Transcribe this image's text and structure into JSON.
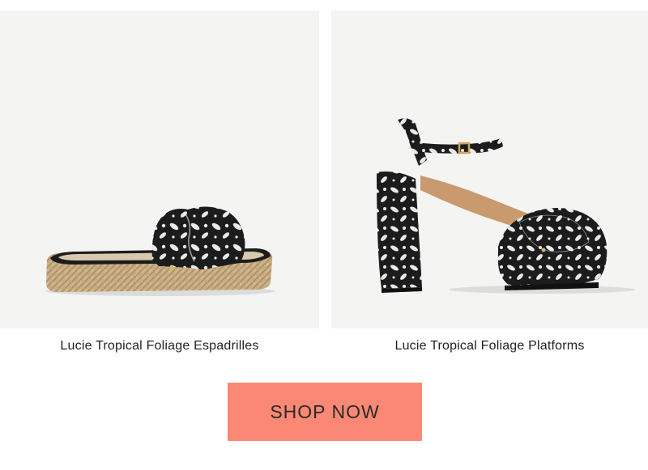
{
  "products": [
    {
      "title": "Lucie Tropical Foliage Espadrilles",
      "image_icon": "espadrille-sandal-image"
    },
    {
      "title": "Lucie Tropical Foliage Platforms",
      "image_icon": "platform-heel-image"
    }
  ],
  "cta": {
    "label": "SHOP NOW",
    "color": "#fa8874"
  },
  "colors": {
    "image_background": "#f4f4f3",
    "pattern_dark": "#1c1c1c",
    "pattern_light": "#e9e9ea",
    "jute": "#c9ad82"
  }
}
